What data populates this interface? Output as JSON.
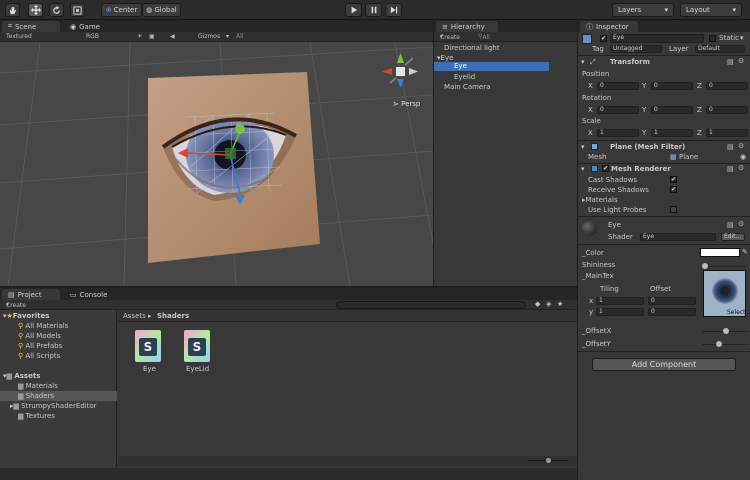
{
  "toolbar": {
    "tools": [
      "hand-icon",
      "move-icon",
      "rotate-icon",
      "scale-icon"
    ],
    "center_label": "Center",
    "global_label": "Global",
    "layers_label": "Layers",
    "layout_label": "Layout"
  },
  "scene": {
    "tab_scene": "Scene",
    "tab_game": "Game",
    "render_mode": "Textured",
    "color_mode": "RGB",
    "gizmos_label": "Gizmos",
    "search_placeholder": "All",
    "persp_label": "Persp"
  },
  "hierarchy": {
    "tab": "Hierarchy",
    "create_label": "Create",
    "search_placeholder": "All",
    "items": [
      "Directional light",
      "Eye",
      "Eye",
      "Eyelid",
      "Main Camera"
    ]
  },
  "inspector": {
    "tab": "Inspector",
    "object_name": "Eye",
    "static_label": "Static",
    "tag_label": "Tag",
    "tag_value": "Untagged",
    "layer_label": "Layer",
    "layer_value": "Default",
    "transform": {
      "title": "Transform",
      "position_label": "Position",
      "rotation_label": "Rotation",
      "scale_label": "Scale",
      "x": "X",
      "y": "Y",
      "z": "Z",
      "position": [
        "0",
        "0",
        "0"
      ],
      "rotation": [
        "0",
        "0",
        "0"
      ],
      "scale": [
        "1",
        "1",
        "1"
      ]
    },
    "mesh_filter": {
      "title": "Plane (Mesh Filter)",
      "mesh_label": "Mesh",
      "mesh_value": "Plane"
    },
    "mesh_renderer": {
      "title": "Mesh Renderer",
      "cast_shadows": "Cast Shadows",
      "receive_shadows": "Receive Shadows",
      "materials": "Materials",
      "light_probes": "Use Light Probes"
    },
    "material": {
      "name": "Eye",
      "shader_label": "Shader",
      "shader_value": "Eye",
      "edit_label": "Edit...",
      "color_label": "_Color",
      "shininess_label": "Shininess",
      "maintex_label": "_MainTex",
      "tiling_label": "Tiling",
      "offset_label": "Offset",
      "x": "x",
      "y": "y",
      "tiling": [
        "1",
        "1"
      ],
      "offset": [
        "0",
        "0"
      ],
      "select_label": "Select",
      "offsetx_label": "_OffsetX",
      "offsety_label": "_OffsetY"
    },
    "add_component": "Add Component"
  },
  "project": {
    "tab_project": "Project",
    "tab_console": "Console",
    "create_label": "Create",
    "favorites_label": "Favorites",
    "favorites": [
      "All Materials",
      "All Models",
      "All Prefabs",
      "All Scripts"
    ],
    "assets_label": "Assets",
    "assets": [
      "Materials",
      "Shaders",
      "StrumpyShaderEditor",
      "Textures"
    ],
    "breadcrumb_root": "Assets",
    "breadcrumb_sep": "▸",
    "breadcrumb_current": "Shaders",
    "files": [
      {
        "name": "Eye",
        "glyph": "S"
      },
      {
        "name": "EyeLid",
        "glyph": "S"
      }
    ]
  },
  "colors": {
    "selection": "#3d6fb5",
    "skin": "#b79273",
    "iris": "#6f7fa8",
    "x_axis": "#d9452e",
    "y_axis": "#7bc043",
    "z_axis": "#3e7ad9"
  }
}
